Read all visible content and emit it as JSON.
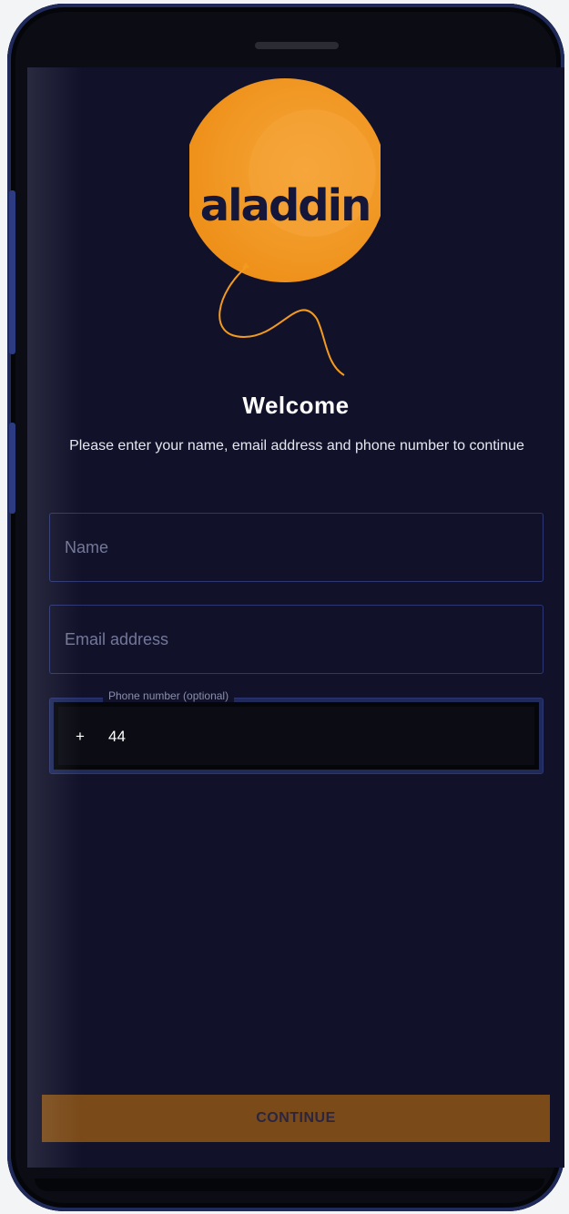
{
  "brand": {
    "logo_text": "aladdin",
    "accent": "#f39a1f",
    "background": "#11122a"
  },
  "header": {
    "title": "Welcome",
    "subtitle": "Please enter your name, email address and phone number to continue"
  },
  "form": {
    "name": {
      "placeholder": "Name",
      "value": ""
    },
    "email": {
      "placeholder": "Email address",
      "value": ""
    },
    "phone": {
      "label": "Phone number (optional)",
      "prefix": "+",
      "country_code": "44"
    }
  },
  "actions": {
    "continue_label": "CONTINUE"
  }
}
